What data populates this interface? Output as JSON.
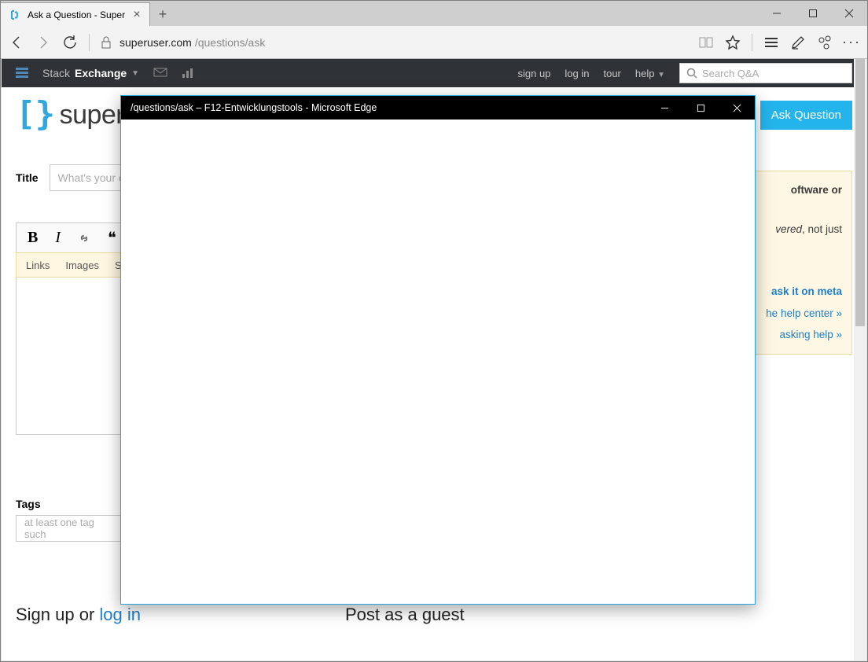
{
  "browser": {
    "tab_title": "Ask a Question - Super",
    "address_host": "superuser.com",
    "address_path": "/questions/ask"
  },
  "se_bar": {
    "brand_a": "Stack",
    "brand_b": "Exchange",
    "links": {
      "signup": "sign up",
      "login": "log in",
      "tour": "tour",
      "help": "help"
    },
    "search_placeholder": "Search Q&A"
  },
  "su": {
    "logo_text": "superuser",
    "ask_button": "Ask Question"
  },
  "form": {
    "title_label": "Title",
    "title_placeholder": "What's your c",
    "toolbar_hints": {
      "links": "Links",
      "images": "Images",
      "st": "St"
    },
    "tags_label": "Tags",
    "tags_placeholder": "at least one tag such"
  },
  "sidebar": {
    "line1a": "oftware or",
    "line2a": "vered",
    "line2b": ", not just",
    "meta": "ask it on meta",
    "help_center": "he help center »",
    "asking_help": "asking help »"
  },
  "bottom": {
    "signup_pre": "Sign up or ",
    "login": "log in",
    "guest": "Post as a guest"
  },
  "devtools": {
    "title": "/questions/ask – F12-Entwicklungstools - Microsoft Edge"
  }
}
